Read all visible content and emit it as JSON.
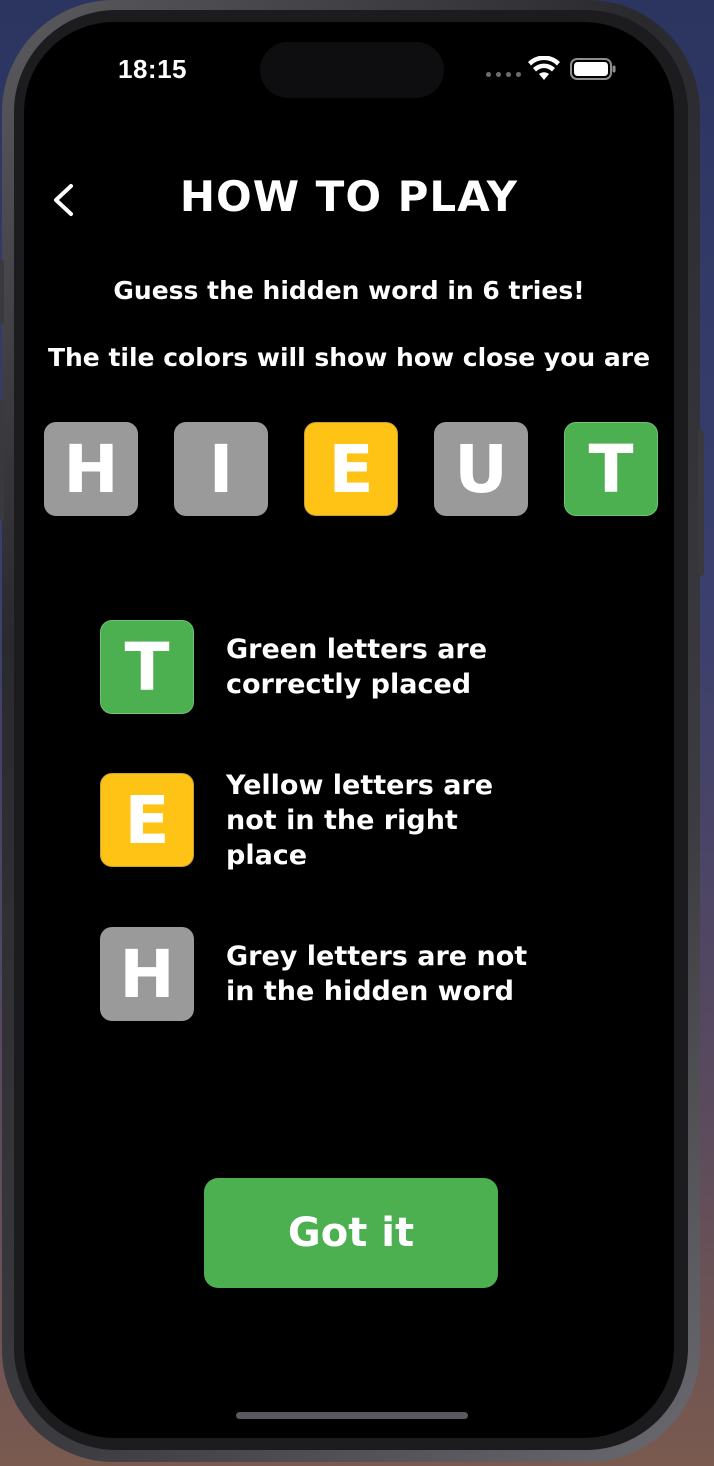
{
  "status_bar": {
    "time": "18:15",
    "signal_icon": "cellular-dots-icon",
    "wifi_icon": "wifi-icon",
    "battery_icon": "battery-icon"
  },
  "header": {
    "back_icon": "chevron-left-icon",
    "title": "HOW TO PLAY"
  },
  "intro": {
    "line1": "Guess the hidden word in 6 tries!",
    "line2": "The tile colors will show how close you are"
  },
  "example_word": [
    {
      "letter": "H",
      "state": "grey"
    },
    {
      "letter": "I",
      "state": "grey"
    },
    {
      "letter": "E",
      "state": "yellow"
    },
    {
      "letter": "U",
      "state": "grey"
    },
    {
      "letter": "T",
      "state": "green"
    }
  ],
  "legend": [
    {
      "letter": "T",
      "state": "green",
      "text": "Green letters are correctly placed"
    },
    {
      "letter": "E",
      "state": "yellow",
      "text": "Yellow letters are not in the right place"
    },
    {
      "letter": "H",
      "state": "grey",
      "text": "Grey letters are not in the hidden word"
    }
  ],
  "actions": {
    "got_it_label": "Got it"
  },
  "colors": {
    "green": "#4caf50",
    "yellow": "#fec315",
    "grey": "#9a9a9a",
    "background": "#000000"
  }
}
